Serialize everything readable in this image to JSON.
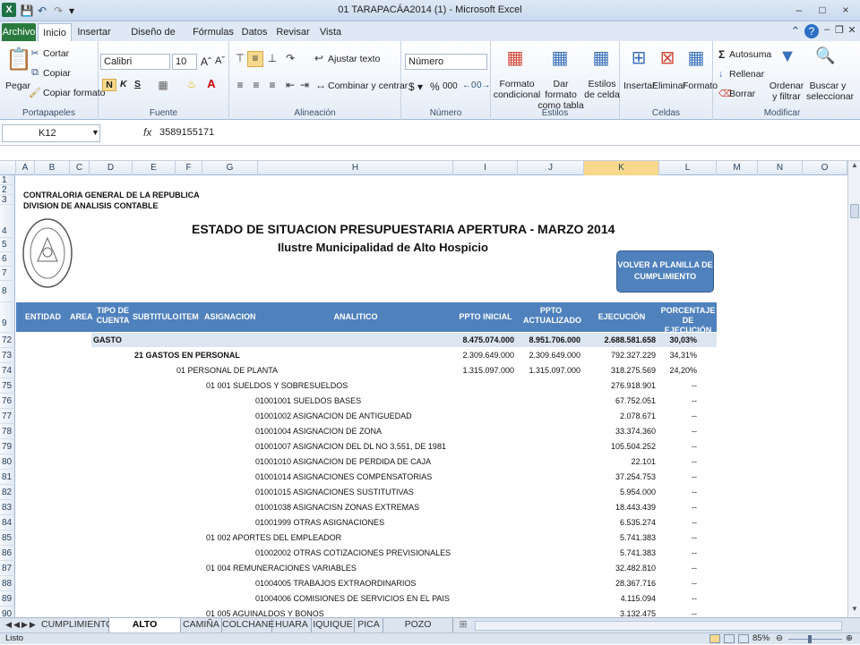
{
  "window": {
    "title": "01 TARAPACÁA2014 (1) - Microsoft Excel",
    "controls": [
      "–",
      "□",
      "×"
    ]
  },
  "ribbon_tabs": [
    "Archivo",
    "Inicio",
    "Insertar",
    "Diseño de página",
    "Fórmulas",
    "Datos",
    "Revisar",
    "Vista"
  ],
  "ribbon": {
    "clipboard": {
      "paste": "Pegar",
      "cut": "Cortar",
      "copy": "Copiar",
      "copy_format": "Copiar formato",
      "label": "Portapapeles"
    },
    "font": {
      "name": "Calibri",
      "size": "10",
      "bold": "N",
      "italic": "K",
      "underline": "S",
      "label": "Fuente"
    },
    "alignment": {
      "wrap": "Ajustar texto",
      "merge": "Combinar y centrar",
      "label": "Alineación"
    },
    "number": {
      "format": "Número",
      "label": "Número",
      "pct": "%",
      "thousands": "000"
    },
    "styles": {
      "conditional": "Formato condicional",
      "as_table": "Dar formato como tabla",
      "cell_styles": "Estilos de celda",
      "label": "Estilos"
    },
    "cells": {
      "insert": "Insertar",
      "delete": "Eliminar",
      "format": "Formato",
      "label": "Celdas"
    },
    "editing": {
      "autosum": "Autosuma",
      "fill": "Rellenar",
      "clear": "Borrar",
      "sort": "Ordenar y filtrar",
      "find": "Buscar y seleccionar",
      "label": "Modificar"
    }
  },
  "formula_bar": {
    "name_box": "K12",
    "fx": "fx",
    "content": "3589155171"
  },
  "columns": [
    "A",
    "B",
    "C",
    "D",
    "E",
    "F",
    "G",
    "H",
    "I",
    "J",
    "K",
    "L",
    "M",
    "N",
    "O"
  ],
  "selected_column": "K",
  "report": {
    "org1": "CONTRALORIA GENERAL DE LA REPUBLICA",
    "org2": "DIVISION DE ANALISIS CONTABLE",
    "title": "ESTADO DE SITUACION PRESUPUESTARIA APERTURA - MARZO 2014",
    "subtitle": "Ilustre Municipalidad de Alto Hospicio",
    "button": "VOLVER A PLANILLA DE CUMPLIMIENTO",
    "headers": {
      "entidad": "ENTIDAD",
      "area": "AREA",
      "tipo": "TIPO DE CUENTA",
      "subtitulo": "SUBTITULO",
      "item": "ITEM",
      "asignacion": "ASIGNACION",
      "analitico": "ANALITICO",
      "ppto_inicial": "PPTO INICIAL",
      "ppto_actualizado": "PPTO ACTUALIZADO",
      "ejecucion": "EJECUCIÓN",
      "porcentaje": "PORCENTAJE DE EJECUCIÓN"
    },
    "rows": [
      {
        "row": "72",
        "text": "GASTO",
        "ppto_inicial": "8.475.074.000",
        "ppto_actualizado": "8.951.706.000",
        "ejecucion": "2.688.581.658",
        "pct": "30,03%"
      },
      {
        "row": "73",
        "text": "21 GASTOS EN PERSONAL",
        "ppto_inicial": "2.309.649.000",
        "ppto_actualizado": "2.309.649.000",
        "ejecucion": "792.327.229",
        "pct": "34,31%"
      },
      {
        "row": "74",
        "text": "01  PERSONAL DE PLANTA",
        "ppto_inicial": "1.315.097.000",
        "ppto_actualizado": "1.315.097.000",
        "ejecucion": "318.275.569",
        "pct": "24,20%"
      },
      {
        "row": "75",
        "text": "01 001  SUELDOS Y SOBRESUELDOS",
        "ejecucion": "276.918.901",
        "pct": "--"
      },
      {
        "row": "76",
        "text": "01001001  SUELDOS BASES",
        "ejecucion": "67.752.051",
        "pct": "--"
      },
      {
        "row": "77",
        "text": "01001002  ASIGNACION DE ANTIGUEDAD",
        "ejecucion": "2.078.671",
        "pct": "--"
      },
      {
        "row": "78",
        "text": "01001004  ASIGNACION DE ZONA",
        "ejecucion": "33.374.360",
        "pct": "--"
      },
      {
        "row": "79",
        "text": "01001007  ASIGNACION DEL DL NO 3.551, DE 1981",
        "ejecucion": "105.504.252",
        "pct": "--"
      },
      {
        "row": "80",
        "text": "01001010  ASIGNACION DE PERDIDA DE CAJA",
        "ejecucion": "22.101",
        "pct": "--"
      },
      {
        "row": "81",
        "text": "01001014  ASIGNACIONES COMPENSATORIAS",
        "ejecucion": "37.254.753",
        "pct": "--"
      },
      {
        "row": "82",
        "text": "01001015  ASIGNACIONES SUSTITUTIVAS",
        "ejecucion": "5.954.000",
        "pct": "--"
      },
      {
        "row": "83",
        "text": "01001038  ASIGNACISN ZONAS EXTREMAS",
        "ejecucion": "18.443.439",
        "pct": "--"
      },
      {
        "row": "84",
        "text": "01001999  OTRAS ASIGNACIONES",
        "ejecucion": "6.535.274",
        "pct": "--"
      },
      {
        "row": "85",
        "text": "01 002  APORTES DEL EMPLEADOR",
        "ejecucion": "5.741.383",
        "pct": "--"
      },
      {
        "row": "86",
        "text": "01002002  OTRAS COTIZACIONES PREVISIONALES",
        "ejecucion": "5.741.383",
        "pct": "--"
      },
      {
        "row": "87",
        "text": "01 004  REMUNERACIONES VARIABLES",
        "ejecucion": "32.482.810",
        "pct": "--"
      },
      {
        "row": "88",
        "text": "01004005  TRABAJOS EXTRAORDINARIOS",
        "ejecucion": "28.367.716",
        "pct": "--"
      },
      {
        "row": "89",
        "text": "01004006  COMISIONES DE SERVICIOS EN EL PAIS",
        "ejecucion": "4.115.094",
        "pct": "--"
      },
      {
        "row": "90",
        "text": "01 005  AGUINALDOS Y BONOS",
        "ejecucion": "3.132.475",
        "pct": "--"
      }
    ]
  },
  "sheet_tabs": [
    "CUMPLIMIENTO",
    "ALTO HOSPICIO",
    "CAMIÑA",
    "COLCHANE",
    "HUARA",
    "IQUIQUE",
    "PICA",
    "POZO ALMONTE"
  ],
  "active_sheet": "ALTO HOSPICIO",
  "status": {
    "mode": "Listo",
    "zoom": "85%"
  }
}
